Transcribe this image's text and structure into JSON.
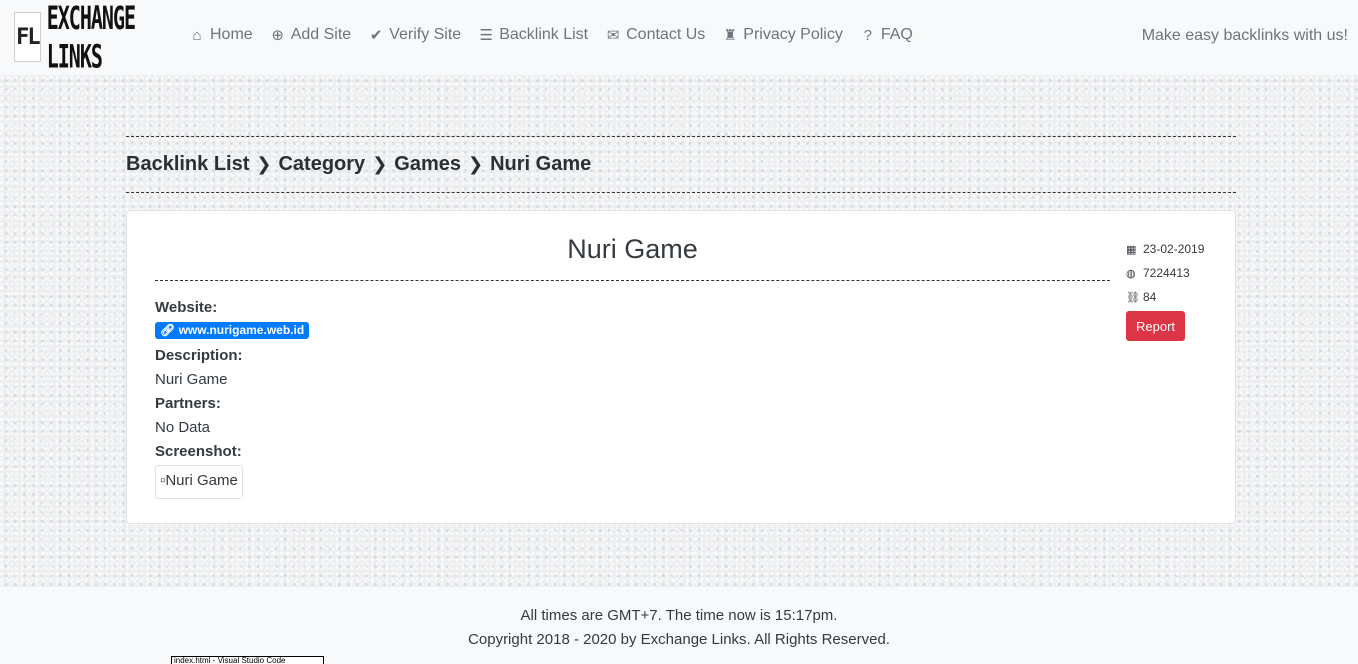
{
  "logo": {
    "mark": "FL",
    "text": "EXCHANGE LINKS"
  },
  "nav": {
    "items": [
      {
        "label": "Home",
        "icon": "home-icon",
        "glyph": "⌂"
      },
      {
        "label": "Add Site",
        "icon": "plus-circle-icon",
        "glyph": "⊕"
      },
      {
        "label": "Verify Site",
        "icon": "check-circle-icon",
        "glyph": "✔"
      },
      {
        "label": "Backlink List",
        "icon": "list-icon",
        "glyph": "☰"
      },
      {
        "label": "Contact Us",
        "icon": "envelope-icon",
        "glyph": "✉"
      },
      {
        "label": "Privacy Policy",
        "icon": "building-icon",
        "glyph": "♜"
      },
      {
        "label": "FAQ",
        "icon": "question-circle-icon",
        "glyph": "?"
      }
    ],
    "tagline": "Make easy backlinks with us!"
  },
  "breadcrumb": [
    "Backlink List",
    "Category",
    "Games",
    "Nuri Game"
  ],
  "card": {
    "title": "Nuri Game",
    "meta": {
      "date": "23-02-2019",
      "rank": "7224413",
      "links": "84"
    },
    "report_label": "Report",
    "website_label": "Website:",
    "website_url": "www.nurigame.web.id",
    "description_label": "Description:",
    "description": "Nuri Game",
    "partners_label": "Partners:",
    "partners": "No Data",
    "screenshot_label": "Screenshot:",
    "screenshot_alt": "Nuri Game"
  },
  "footer": {
    "line1": "All times are GMT+7. The time now is 15:17pm.",
    "line2": "Copyright 2018 - 2020 by Exchange Links. All Rights Reserved."
  },
  "taskbar_thumb": "index.html - Visual Studio Code",
  "colors": {
    "accent": "#007bff",
    "danger": "#dc3545",
    "navbar_bg": "#f8f9fa"
  }
}
